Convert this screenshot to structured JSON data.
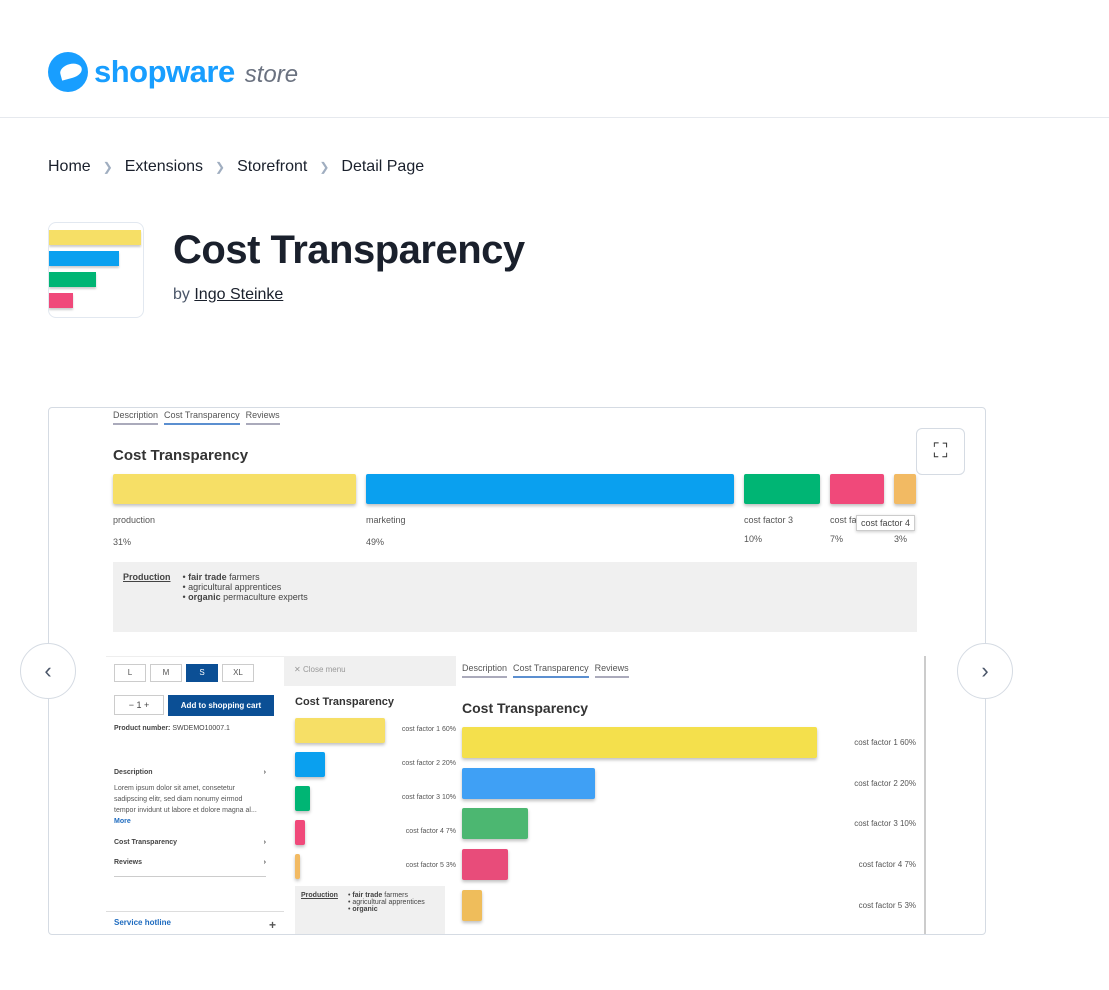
{
  "brand": {
    "name": "shopware",
    "suffix": "store",
    "color": "#189eff"
  },
  "breadcrumb": [
    "Home",
    "Extensions",
    "Storefront",
    "Detail Page"
  ],
  "product": {
    "title": "Cost Transparency",
    "by": "by",
    "author": "Ingo Steinke"
  },
  "icon_colors": [
    "#f6df66",
    "#0aa0ef",
    "#00b574",
    "#f0497a"
  ],
  "screenshot": {
    "tabs": [
      "Description",
      "Cost Transparency",
      "Reviews"
    ],
    "heading": "Cost Transparency",
    "bars": [
      {
        "label": "production",
        "pct": "31%",
        "color": "#f6df66"
      },
      {
        "label": "marketing",
        "pct": "49%",
        "color": "#0aa0ef"
      },
      {
        "label": "cost factor 3",
        "pct": "10%",
        "color": "#00b574"
      },
      {
        "label": "cost fa",
        "pct": "7%",
        "color": "#f0497a"
      },
      {
        "label": "",
        "pct": "3%",
        "color": "#f2ba63"
      }
    ],
    "tooltip": "cost factor 4",
    "detail": {
      "title": "Production",
      "items": [
        [
          "fair trade",
          " farmers"
        ],
        [
          "",
          "agricultural apprentices"
        ],
        [
          "organic",
          " permaculture experts"
        ]
      ]
    },
    "mobile": {
      "sizes": [
        "L",
        "M",
        "S",
        "XL"
      ],
      "selected_size": "S",
      "qty": "1",
      "cart": "Add to shopping cart",
      "product_number_label": "Product number:",
      "product_number": "SWDEMO10007.1",
      "description_title": "Description",
      "description": "Lorem ipsum dolor sit amet, consetetur sadipscing elitr, sed diam nonumy eirmod tempor invidunt ut labore et dolore magna al...",
      "more": "More",
      "cost_transparency": "Cost Transparency",
      "reviews": "Reviews",
      "hotline": "Service hotline",
      "close_menu": "Close menu"
    },
    "side_bars": [
      {
        "label": "cost factor 1",
        "pct": "60%",
        "color": "#f6df66"
      },
      {
        "label": "cost factor 2",
        "pct": "20%",
        "color": "#0aa0ef"
      },
      {
        "label": "cost factor 3",
        "pct": "10%",
        "color": "#00b574"
      },
      {
        "label": "cost factor 4",
        "pct": "7%",
        "color": "#f0497a"
      },
      {
        "label": "cost factor 5",
        "pct": "3%",
        "color": "#f2ba63"
      }
    ],
    "desktop_bars": [
      {
        "label": "cost factor 1",
        "pct": "60%",
        "color": "#f4e04c"
      },
      {
        "label": "cost factor 2",
        "pct": "20%",
        "color": "#3fa0f5"
      },
      {
        "label": "cost factor 3",
        "pct": "10%",
        "color": "#4cb771"
      },
      {
        "label": "cost factor 4",
        "pct": "7%",
        "color": "#e84c7a"
      },
      {
        "label": "cost factor 5",
        "pct": "3%",
        "color": "#efbd5b"
      }
    ],
    "side_detail": {
      "title": "Production",
      "items": [
        [
          "fair trade",
          " farmers"
        ],
        [
          "",
          "agricultural apprentices"
        ],
        [
          "organic",
          ""
        ]
      ]
    }
  },
  "controls": {
    "prev": "‹",
    "next": "›",
    "fullscreen": "⛶"
  }
}
